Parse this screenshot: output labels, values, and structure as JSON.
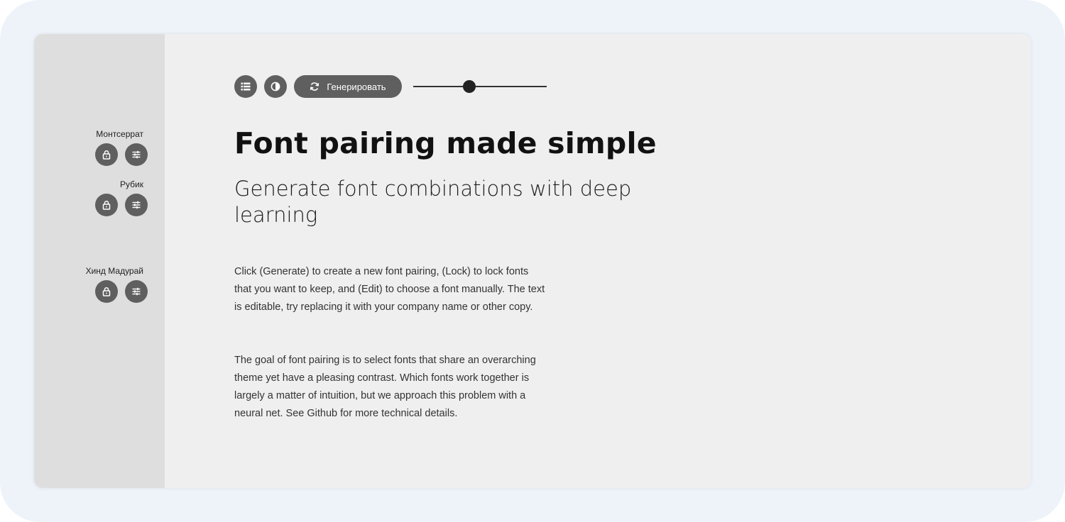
{
  "toolbar": {
    "list_icon": "list-icon",
    "contrast_icon": "contrast-icon",
    "generate_icon": "refresh-icon",
    "generate_label": "Генерировать",
    "slider_value": 0.42
  },
  "sidebar": {
    "fonts": [
      {
        "name": "Монтсеррат",
        "lock_icon": "lock-icon",
        "edit_icon": "sliders-icon"
      },
      {
        "name": "Рубик",
        "lock_icon": "lock-icon",
        "edit_icon": "sliders-icon"
      },
      {
        "name": "Хинд Мадурай",
        "lock_icon": "lock-icon",
        "edit_icon": "sliders-icon"
      }
    ]
  },
  "content": {
    "title": "Font pairing made simple",
    "subtitle": "Generate font combinations with deep learning",
    "paragraph1": "Click (Generate) to create a new font pairing, (Lock) to lock fonts that you want to keep, and (Edit) to choose a font manually. The text is editable, try replacing it with your company name or other copy.",
    "paragraph2": "The goal of font pairing is to select fonts that share an overarching theme yet have a pleasing contrast. Which fonts work together is largely a matter of intuition, but we approach this problem with a neural net. See Github for more technical details."
  },
  "colors": {
    "button_bg": "#5f5f5f",
    "sidebar_bg": "#dedede",
    "canvas_bg": "#efefef"
  }
}
